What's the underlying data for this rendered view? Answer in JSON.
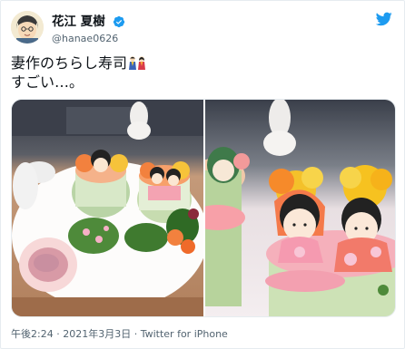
{
  "tweet": {
    "display_name": "花江 夏樹",
    "handle": "@hanae0626",
    "text_line1": "妻作のちらし寿司",
    "text_line2": "すごい…。",
    "time": "午後2:24",
    "separator": "·",
    "date": "2021年3月3日",
    "source": "Twitter for iPhone"
  },
  "icons": {
    "verified": "verified-badge-icon",
    "brand": "twitter-bird-icon",
    "emoji": "hina-dolls-emoji"
  },
  "colors": {
    "brand_blue": "#1d9bf0",
    "text": "#0f1419",
    "secondary": "#536471"
  }
}
